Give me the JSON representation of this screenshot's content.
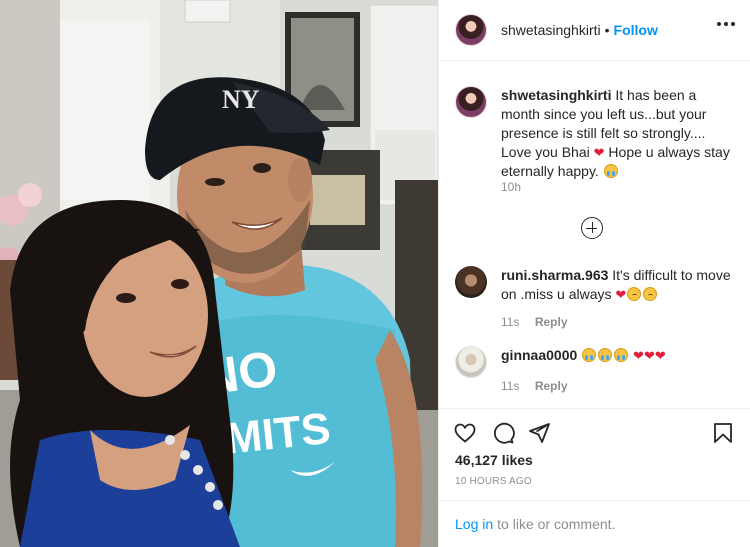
{
  "post": {
    "username": "shwetasinghkirti",
    "follow_label": "Follow",
    "header_separator": "•"
  },
  "caption": {
    "username": "shwetasinghkirti",
    "text_part1": "It has been a month since you left us...but your presence is still felt so strongly.... Love you Bhai",
    "text_part2": "Hope u always stay eternally happy.",
    "time": "10h"
  },
  "comments": [
    {
      "username": "runi.sharma.963",
      "text": "It's difficult to move on .miss u always",
      "time": "11s",
      "reply_label": "Reply"
    },
    {
      "username": "ginnaa0000",
      "text": "",
      "time": "11s",
      "reply_label": "Reply"
    }
  ],
  "stats": {
    "likes": "46,127 likes",
    "posted": "10 HOURS AGO"
  },
  "login": {
    "link_label": "Log in",
    "rest_text": "to like or comment."
  },
  "photo": {
    "shirt_text_line1": "NO",
    "shirt_text_line2": "IMITS",
    "cap_logo": "NY"
  },
  "colors": {
    "accent": "#0095f6",
    "heart": "#e0203c",
    "muted": "#8e8e8e",
    "text": "#262626"
  },
  "icons": [
    "more-icon",
    "plus-circle-icon",
    "heart-icon",
    "comment-icon",
    "share-icon",
    "bookmark-icon"
  ]
}
